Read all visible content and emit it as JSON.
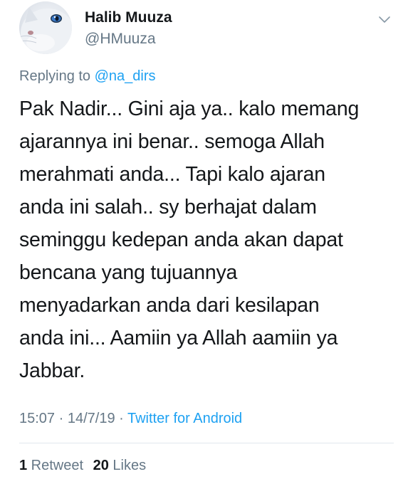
{
  "user": {
    "display_name": "Halib Muuza",
    "handle": "@HMuuza"
  },
  "reply": {
    "prefix": "Replying to ",
    "mention": "@na_dirs"
  },
  "tweet": {
    "lines": [
      "Pak Nadir... Gini aja ya.. kalo memang",
      "ajarannya ini benar.. semoga Allah",
      "merahmati anda... Tapi kalo ajaran",
      "anda ini salah.. sy berhajat dalam",
      "seminggu kedepan anda akan dapat",
      "bencana yang tujuannya",
      "menyadarkan anda dari kesilapan",
      "anda ini... Aamiin ya Allah aamiin ya",
      "Jabbar."
    ]
  },
  "meta": {
    "time": "15:07",
    "separator1": " · ",
    "date": "14/7/19",
    "separator2": " · ",
    "source": "Twitter for Android"
  },
  "stats": {
    "retweet_count": "1",
    "retweet_label": " Retweet",
    "like_count": "20",
    "like_label": " Likes"
  },
  "icons": {
    "menu": "chevron-down-icon",
    "avatar": "white-cat-avatar"
  },
  "colors": {
    "link": "#1da1f2",
    "secondary_text": "#657786",
    "primary_text": "#14171a",
    "divider": "#e1e8ed"
  }
}
